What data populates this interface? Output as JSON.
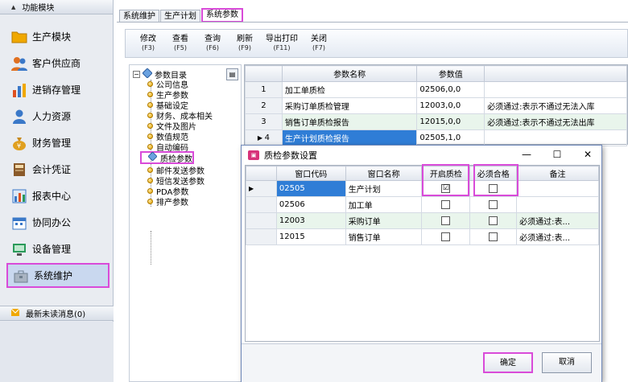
{
  "sidebar": {
    "header": "功能模块",
    "items": [
      {
        "label": "生产模块",
        "icon": "folder-icon",
        "color": "#f0a800"
      },
      {
        "label": "客户供应商",
        "icon": "people-icon",
        "color": "#e07020"
      },
      {
        "label": "进销存管理",
        "icon": "bar-chart-icon",
        "color": "#e05020"
      },
      {
        "label": "人力资源",
        "icon": "person-icon",
        "color": "#3a78c8"
      },
      {
        "label": "财务管理",
        "icon": "money-bag-icon",
        "color": "#c88a20"
      },
      {
        "label": "会计凭证",
        "icon": "ledger-icon",
        "color": "#8a5a2a"
      },
      {
        "label": "报表中心",
        "icon": "report-chart-icon",
        "color": "#3a78c8"
      },
      {
        "label": "协同办公",
        "icon": "calendar-icon",
        "color": "#3a78c8"
      },
      {
        "label": "设备管理",
        "icon": "equipment-icon",
        "color": "#2a9a5a"
      },
      {
        "label": "系统维护",
        "icon": "toolbox-icon",
        "color": "#708090"
      }
    ],
    "messages": "最新未读消息(0)"
  },
  "tabs": [
    "系统维护",
    "生产计划",
    "系统参数"
  ],
  "toolbar": [
    {
      "label": "修改",
      "key": "(F3)"
    },
    {
      "label": "查看",
      "key": "(F5)"
    },
    {
      "label": "查询",
      "key": "(F6)"
    },
    {
      "label": "刷新",
      "key": "(F9)"
    },
    {
      "label": "导出打印",
      "key": "(F11)"
    },
    {
      "label": "关闭",
      "key": "(F7)"
    }
  ],
  "tree": {
    "root": "参数目录",
    "nodes": [
      "公司信息",
      "生产参数",
      "基础设定",
      "财务、成本相关",
      "文件及图片",
      "数值规范",
      "自动编码",
      "质检参数",
      "邮件发送参数",
      "短信发送参数",
      "PDA参数",
      "排产参数"
    ]
  },
  "grid": {
    "headers": [
      "参数名称",
      "参数值",
      ""
    ],
    "rows": [
      {
        "num": "1",
        "name": "加工单质检",
        "value": "02506,0,0",
        "note": ""
      },
      {
        "num": "2",
        "name": "采购订单质检管理",
        "value": "12003,0,0",
        "note": "必须通过:表示不通过无法入库"
      },
      {
        "num": "3",
        "name": "销售订单质检报告",
        "value": "12015,0,0",
        "note": "必须通过:表示不通过无法出库"
      },
      {
        "num": "4",
        "name": "生产计划质检报告",
        "value": "02505,1,0",
        "note": ""
      }
    ]
  },
  "dialog": {
    "title": "质检参数设置",
    "headers": [
      "窗口代码",
      "窗口名称",
      "开启质检",
      "必须合格",
      "备注"
    ],
    "rows": [
      {
        "code": "02505",
        "name": "生产计划",
        "enable": "☑",
        "must": "",
        "note": ""
      },
      {
        "code": "02506",
        "name": "加工单",
        "enable": "",
        "must": "",
        "note": ""
      },
      {
        "code": "12003",
        "name": "采购订单",
        "enable": "",
        "must": "",
        "note": "必须通过:表..."
      },
      {
        "code": "12015",
        "name": "销售订单",
        "enable": "",
        "must": "",
        "note": "必须通过:表..."
      }
    ],
    "ok": "确定",
    "cancel": "取消"
  },
  "colors": {
    "accent": "#2f7dd6",
    "highlight_border": "#d94bd9",
    "alt_row": "#e9f5ec"
  }
}
